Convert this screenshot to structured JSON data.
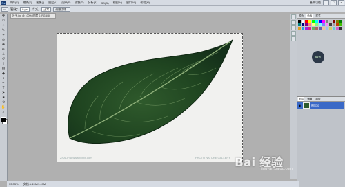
{
  "app": {
    "logo_text": "Ps"
  },
  "menubar": {
    "items": [
      "文件(F)",
      "编辑(E)",
      "图像(I)",
      "图层(L)",
      "选择(S)",
      "滤镜(T)",
      "分析(A)",
      "3D(D)",
      "视图(V)",
      "窗口(W)",
      "帮助(H)"
    ],
    "workspace_label": "基本功能",
    "win_controls": [
      "-",
      "□",
      "×"
    ]
  },
  "options": {
    "feather_label": "羽化:",
    "feather_value": "0 px",
    "style_label": "样式:",
    "style_value": "正常",
    "refine_btn": "调整边缘..."
  },
  "document": {
    "tab_title": "叶子.jpg @ 100% (图层 0, RGB/8)"
  },
  "canvas": {
    "watermark_left": "ZHAOPAI www.xxxxx.com",
    "watermark_right": "PHOTO NATURE GALLERY"
  },
  "panels": {
    "tabs": [
      "颜色",
      "色板",
      "样式"
    ],
    "adjust_label": "61%",
    "layers_tabs": [
      "图层",
      "通道",
      "路径"
    ],
    "layer_name": "图层 0",
    "swatch_colors": [
      "#000000",
      "#ffffff",
      "#ff0000",
      "#ffff00",
      "#00ff00",
      "#00ffff",
      "#0000ff",
      "#ff00ff",
      "#808080",
      "#c0c0c0",
      "#800000",
      "#808000",
      "#008000",
      "#008080",
      "#000080",
      "#800080",
      "#ff8080",
      "#ffff80",
      "#80ff80",
      "#80ffff",
      "#8080ff",
      "#ff80ff",
      "#404040",
      "#a0a0a0",
      "#c04000",
      "#40c000",
      "#e0a020",
      "#20a0e0",
      "#a020e0",
      "#e02080",
      "#60b060",
      "#b06060",
      "#6060b0",
      "#f0c0a0",
      "#a0c0f0",
      "#d0d060",
      "#60d0d0",
      "#d060d0",
      "#303030"
    ]
  },
  "status": {
    "zoom": "33.33%",
    "info": "文档:1.49M/1.49M"
  },
  "watermark": {
    "brand": "Bai 经验",
    "url": "jingyan.baidu.com"
  }
}
